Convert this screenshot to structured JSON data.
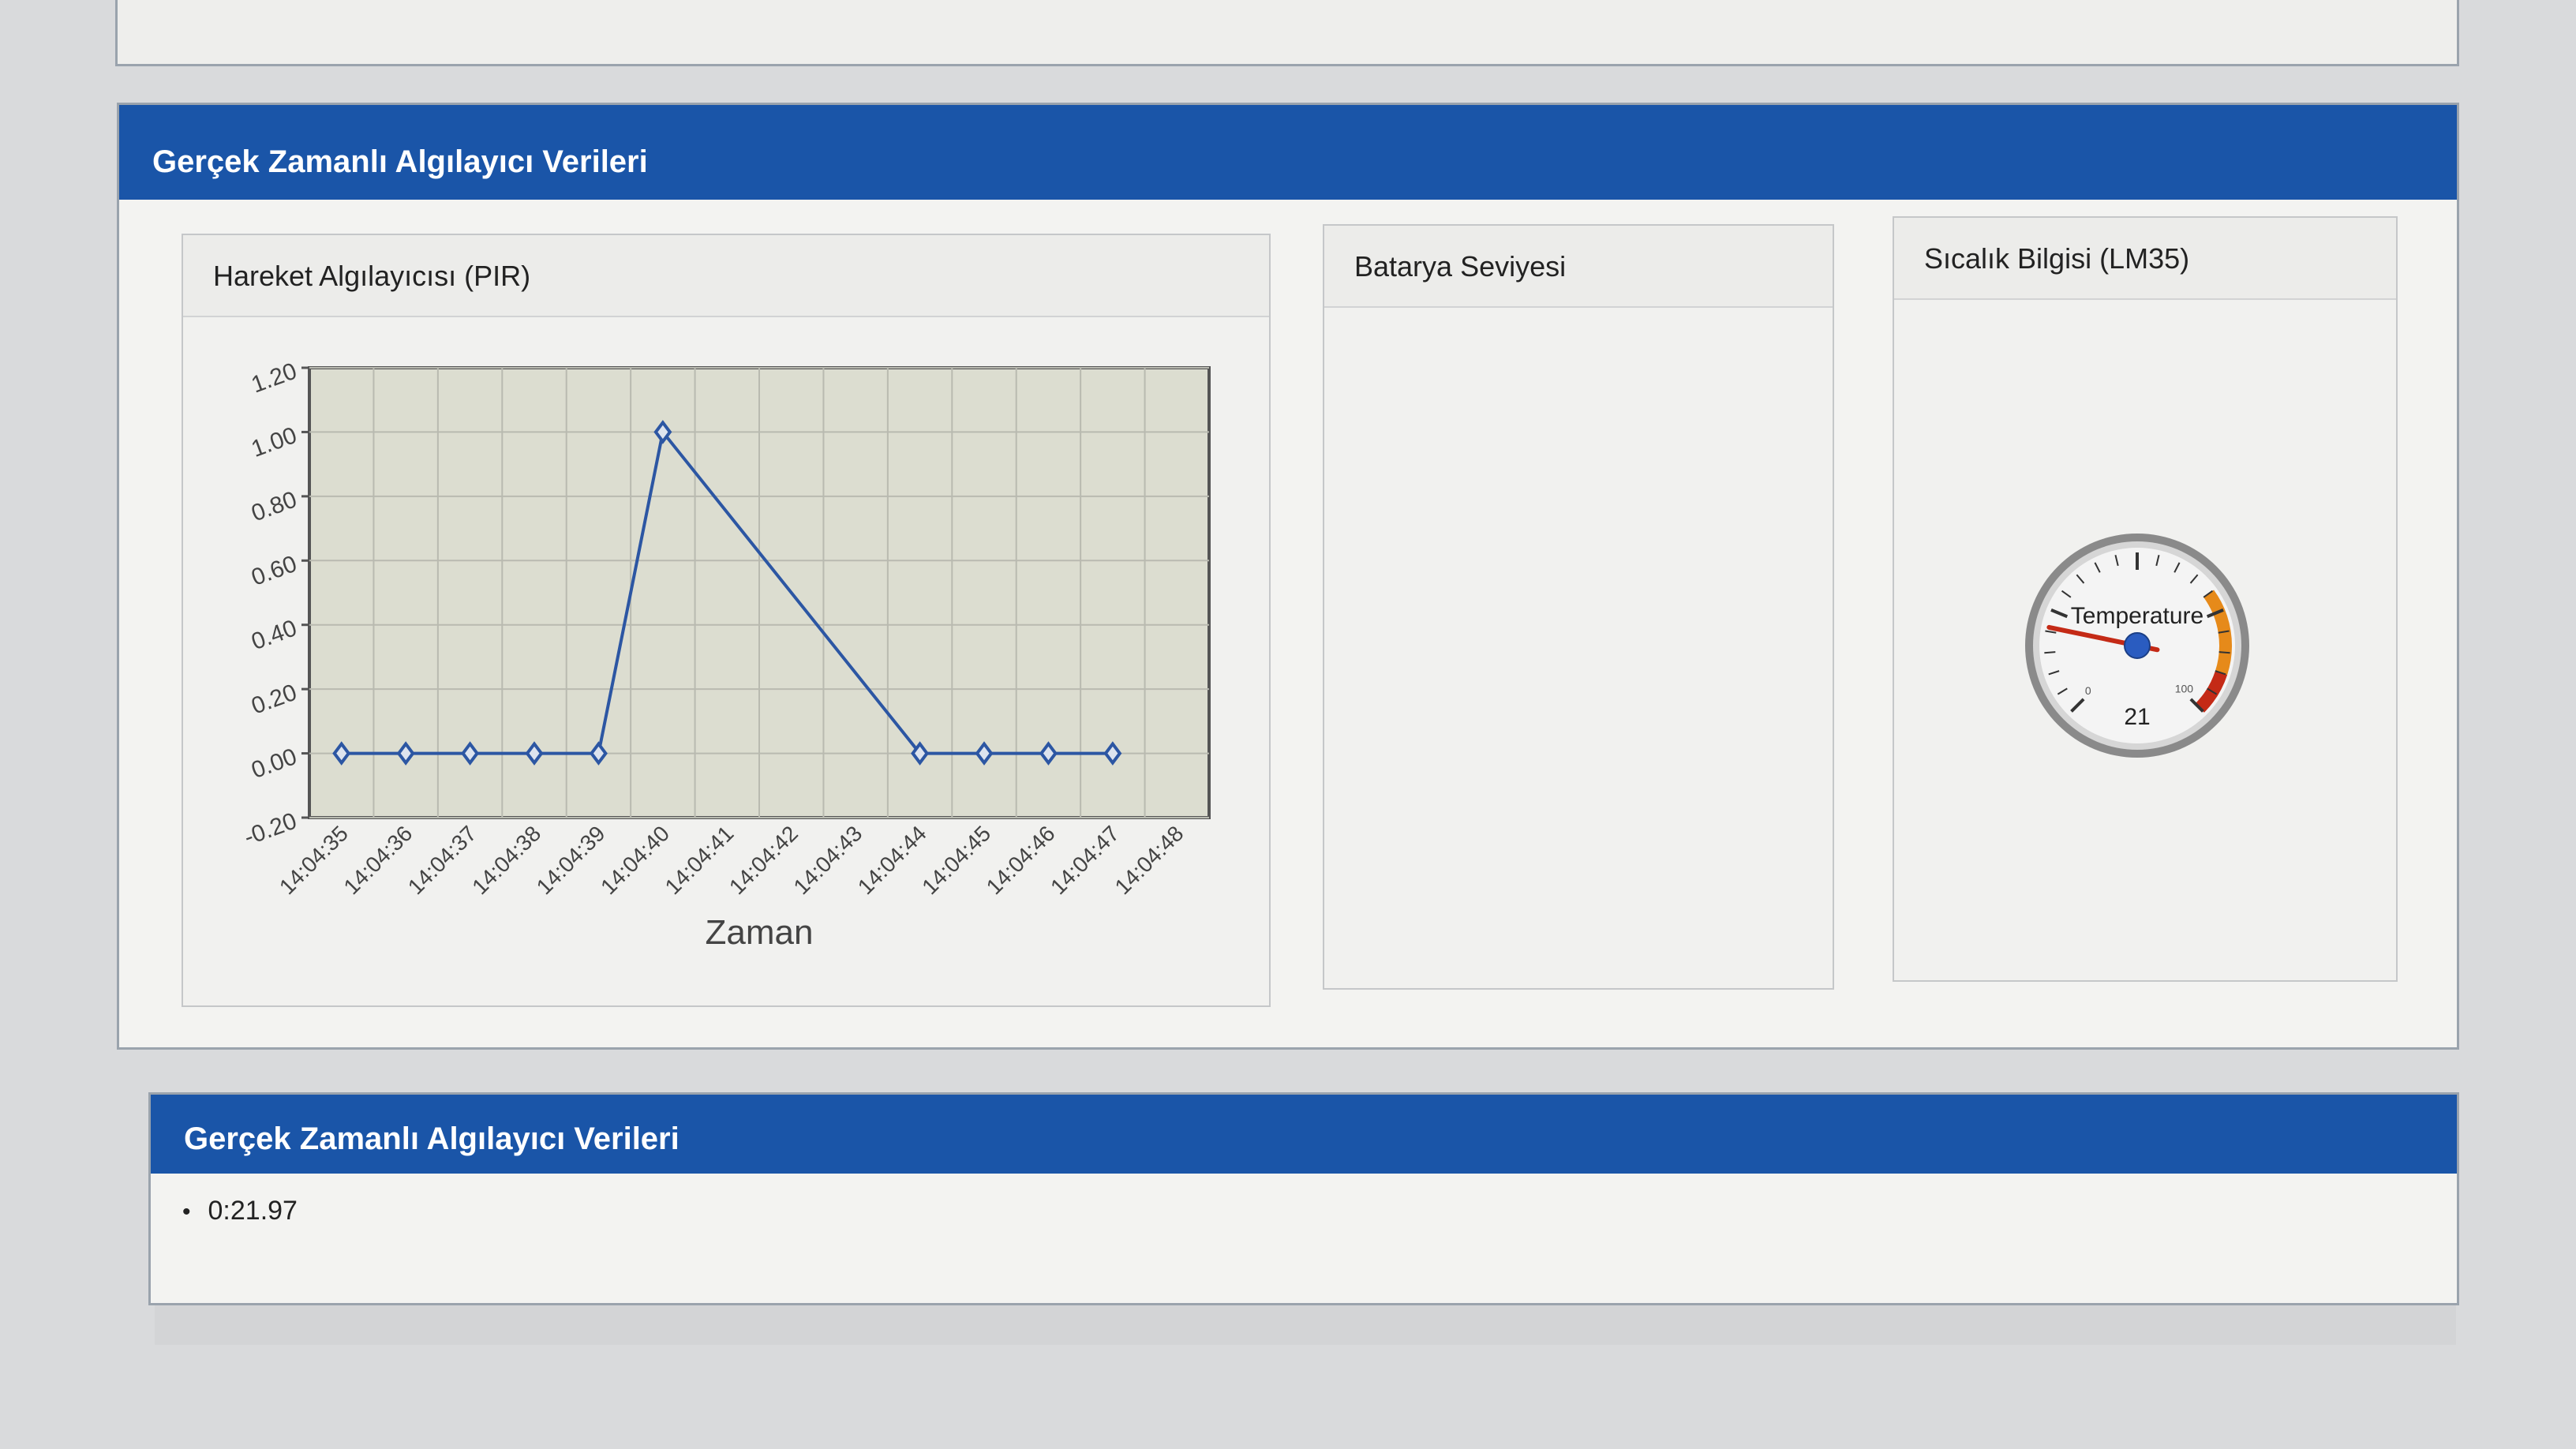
{
  "panel_title": "Gerçek Zamanlı Algılayıcı Verileri",
  "pir": {
    "title": "Hareket Algılayıcısı (PIR)"
  },
  "battery": {
    "title": "Batarya Seviyesi"
  },
  "temperature": {
    "title": "Sıcalık Bilgisi (LM35)",
    "gauge_label": "Temperature",
    "gauge_min": "0",
    "gauge_max": "100",
    "gauge_value": 21,
    "gauge_value_text": "21"
  },
  "readings": {
    "title": "Gerçek Zamanlı Algılayıcı Verileri",
    "items": [
      "0:21.97"
    ]
  },
  "chart_data": {
    "type": "line",
    "x": [
      "14:04:35",
      "14:04:36",
      "14:04:37",
      "14:04:38",
      "14:04:39",
      "14:04:40",
      "14:04:41",
      "14:04:42",
      "14:04:43",
      "14:04:44",
      "14:04:45",
      "14:04:46",
      "14:04:47",
      "14:04:48"
    ],
    "y_ticks": [
      "-0.20",
      "0.00",
      "0.20",
      "0.40",
      "0.60",
      "0.80",
      "1.00",
      "1.20"
    ],
    "ylim": [
      -0.2,
      1.2
    ],
    "xlabel": "Zaman",
    "series": [
      {
        "points": [
          [
            "14:04:35",
            0
          ],
          [
            "14:04:36",
            0
          ],
          [
            "14:04:37",
            0
          ],
          [
            "14:04:38",
            0
          ],
          [
            "14:04:39",
            0
          ],
          [
            "14:04:40",
            1
          ],
          [
            "14:04:44",
            0
          ],
          [
            "14:04:45",
            0
          ],
          [
            "14:04:46",
            0
          ],
          [
            "14:04:47",
            0
          ]
        ],
        "color": "#2c56a3"
      }
    ],
    "grid": true,
    "plot_bg": "#dcddd0"
  },
  "colors": {
    "heading": "#1a55a8",
    "line": "#2c56a3",
    "gauge_danger": "#c42a16",
    "gauge_warn": "#e68a1a"
  }
}
